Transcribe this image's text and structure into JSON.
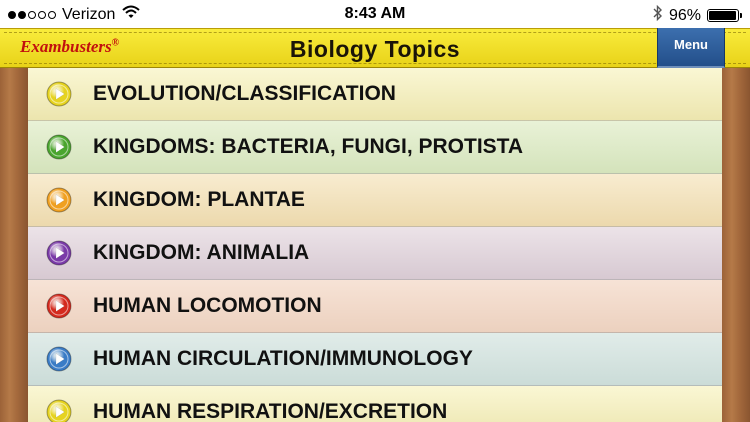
{
  "status_bar": {
    "carrier": "Verizon",
    "signal_bars_filled": 2,
    "signal_bars_total": 5,
    "time": "8:43 AM",
    "battery_percent_label": "96%",
    "battery_level": 0.96,
    "icons": [
      "wifi-icon",
      "bluetooth-icon",
      "battery-icon"
    ]
  },
  "header": {
    "brand_name": "Exambusters",
    "brand_mark": "®",
    "brand_color": "#c2100e",
    "title": "Biology Topics",
    "menu_label": "Menu",
    "header_color": "#f3e234",
    "menu_color": "#2f5f9c"
  },
  "topics": [
    {
      "label": "EVOLUTION/CLASSIFICATION",
      "icon": "play-icon",
      "icon_color": "#e6d320"
    },
    {
      "label": "KINGDOMS: BACTERIA, FUNGI, PROTISTA",
      "icon": "play-icon",
      "icon_color": "#4aa52e"
    },
    {
      "label": "KINGDOM: PLANTAE",
      "icon": "play-icon",
      "icon_color": "#f0a020"
    },
    {
      "label": "KINGDOM: ANIMALIA",
      "icon": "play-icon",
      "icon_color": "#7a3aa8"
    },
    {
      "label": "HUMAN LOCOMOTION",
      "icon": "play-icon",
      "icon_color": "#d42a1e"
    },
    {
      "label": "HUMAN CIRCULATION/IMMUNOLOGY",
      "icon": "play-icon",
      "icon_color": "#3a7cc6"
    },
    {
      "label": "HUMAN RESPIRATION/EXCRETION",
      "icon": "play-icon",
      "icon_color": "#e6d320"
    }
  ]
}
